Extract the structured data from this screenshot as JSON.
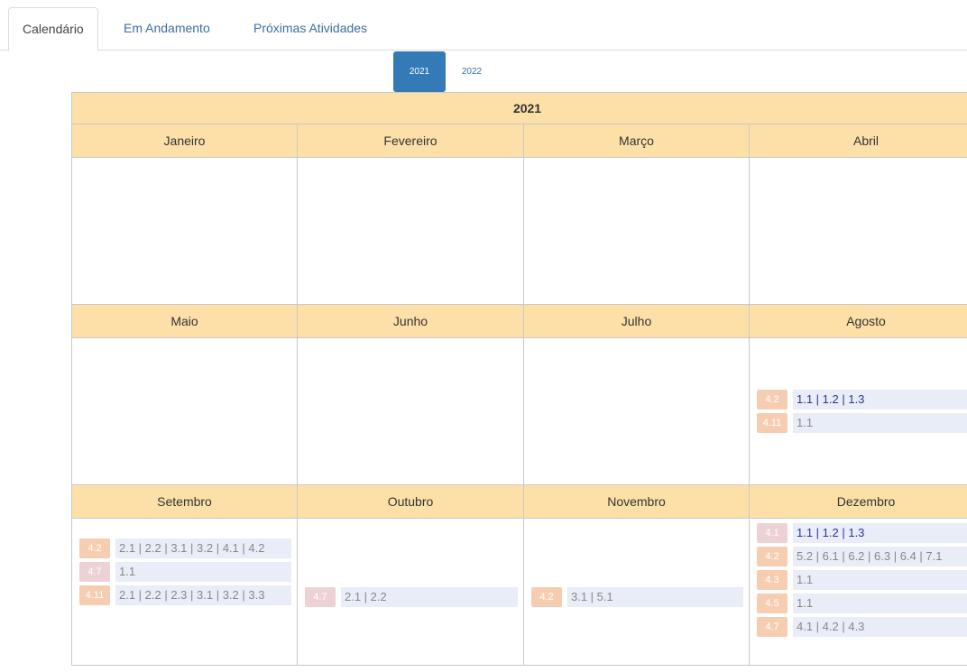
{
  "tabs": [
    {
      "label": "Calendário",
      "active": true
    },
    {
      "label": "Em Andamento",
      "active": false
    },
    {
      "label": "Próximas Atividades",
      "active": false
    }
  ],
  "years": [
    {
      "label": "2021",
      "active": true
    },
    {
      "label": "2022",
      "active": false
    }
  ],
  "calendar": {
    "year_title": "2021",
    "months": [
      {
        "name": "Janeiro",
        "activities": []
      },
      {
        "name": "Fevereiro",
        "activities": []
      },
      {
        "name": "Março",
        "activities": []
      },
      {
        "name": "Abril",
        "activities": []
      },
      {
        "name": "Maio",
        "activities": []
      },
      {
        "name": "Junho",
        "activities": []
      },
      {
        "name": "Julho",
        "activities": []
      },
      {
        "name": "Agosto",
        "activities": [
          {
            "badge": "4.2",
            "badge_color": "orange",
            "items": "1.1 | 1.2 | 1.3",
            "text_style": "dark"
          },
          {
            "badge": "4.11",
            "badge_color": "orange",
            "items": "1.1",
            "text_style": "grey"
          }
        ]
      },
      {
        "name": "Setembro",
        "activities": [
          {
            "badge": "4.2",
            "badge_color": "orange",
            "items": "2.1 | 2.2 | 3.1 | 3.2 | 4.1 | 4.2",
            "text_style": "grey"
          },
          {
            "badge": "4.7",
            "badge_color": "pink",
            "items": "1.1",
            "text_style": "grey"
          },
          {
            "badge": "4.11",
            "badge_color": "orange",
            "items": "2.1 | 2.2 | 2.3 | 3.1 | 3.2 | 3.3",
            "text_style": "grey"
          }
        ]
      },
      {
        "name": "Outubro",
        "activities": [
          {
            "badge": "4.7",
            "badge_color": "pink",
            "items": "2.1 | 2.2",
            "text_style": "grey"
          }
        ]
      },
      {
        "name": "Novembro",
        "activities": [
          {
            "badge": "4.2",
            "badge_color": "orange",
            "items": "3.1 | 5.1",
            "text_style": "grey"
          }
        ]
      },
      {
        "name": "Dezembro",
        "activities": [
          {
            "badge": "4.1",
            "badge_color": "pink",
            "items": "1.1 | 1.2 | 1.3",
            "text_style": "dark"
          },
          {
            "badge": "4.2",
            "badge_color": "orange",
            "items": "5.2 | 6.1 | 6.2 | 6.3 | 6.4 | 7.1",
            "text_style": "grey"
          },
          {
            "badge": "4.3",
            "badge_color": "orange",
            "items": "1.1",
            "text_style": "grey"
          },
          {
            "badge": "4.5",
            "badge_color": "orange",
            "items": "1.1",
            "text_style": "grey"
          },
          {
            "badge": "4.7",
            "badge_color": "orange",
            "items": "4.1 | 4.2 | 4.3",
            "text_style": "grey"
          }
        ]
      }
    ]
  },
  "colors": {
    "header_bg": "#fde0a8",
    "active_pill": "#337ab7",
    "link": "#3a6ea5",
    "badge_orange": "#f6cdb1",
    "badge_pink": "#ecd2d4",
    "item_bg": "#e9edf8"
  }
}
